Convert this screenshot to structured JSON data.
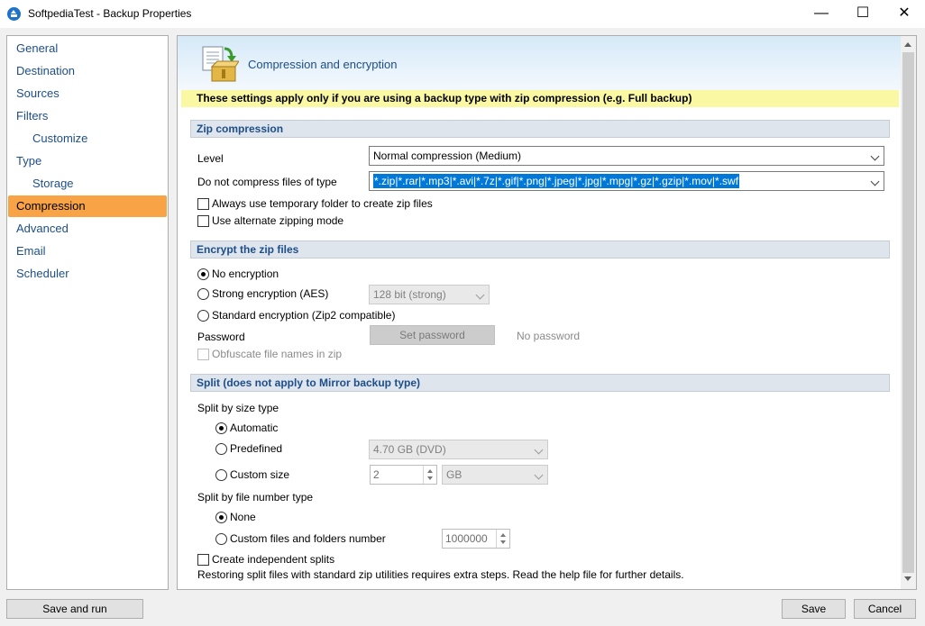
{
  "window": {
    "title": "SoftpediaTest - Backup Properties",
    "minimize_glyph": "—",
    "maximize_glyph": "☐",
    "close_glyph": "✕"
  },
  "sidebar": {
    "items": [
      {
        "label": "General"
      },
      {
        "label": "Destination"
      },
      {
        "label": "Sources"
      },
      {
        "label": "Filters"
      },
      {
        "label": "Customize"
      },
      {
        "label": "Type"
      },
      {
        "label": "Storage"
      },
      {
        "label": "Compression",
        "active": true
      },
      {
        "label": "Advanced"
      },
      {
        "label": "Email"
      },
      {
        "label": "Scheduler"
      }
    ]
  },
  "header": {
    "title": "Compression and encryption",
    "icon": "zip-box-icon"
  },
  "notice": "These settings apply only if you are using a backup type with zip compression (e.g. Full backup)",
  "zip": {
    "section_title": "Zip compression",
    "level_label": "Level",
    "level_value": "Normal compression (Medium)",
    "no_compress_label": "Do not compress files of type",
    "no_compress_value": "*.zip|*.rar|*.mp3|*.avi|*.7z|*.gif|*.png|*.jpeg|*.jpg|*.mpg|*.gz|*.gzip|*.mov|*.swf",
    "temp_folder_label": "Always use temporary folder to create zip files",
    "alt_mode_label": "Use alternate zipping mode"
  },
  "encrypt": {
    "section_title": "Encrypt the zip files",
    "none_label": "No encryption",
    "strong_label": "Strong encryption (AES)",
    "strong_bits": "128 bit (strong)",
    "standard_label": "Standard encryption (Zip2 compatible)",
    "password_label": "Password",
    "set_password_label": "Set password",
    "password_status": "No password",
    "obfuscate_label": "Obfuscate file names in zip"
  },
  "split": {
    "section_title": "Split (does not apply to Mirror backup type)",
    "by_size_label": "Split by size type",
    "automatic_label": "Automatic",
    "predefined_label": "Predefined",
    "predefined_value": "4.70 GB (DVD)",
    "custom_size_label": "Custom size",
    "custom_size_value": "2",
    "custom_size_unit": "GB",
    "by_number_label": "Split by file number type",
    "none_label": "None",
    "custom_number_label": "Custom files and folders number",
    "custom_number_value": "1000000",
    "independent_label": "Create independent splits",
    "note": "Restoring split files with standard zip utilities requires extra steps. Read the help file for further details."
  },
  "footer": {
    "save_and_run": "Save and run",
    "save": "Save",
    "cancel": "Cancel"
  }
}
